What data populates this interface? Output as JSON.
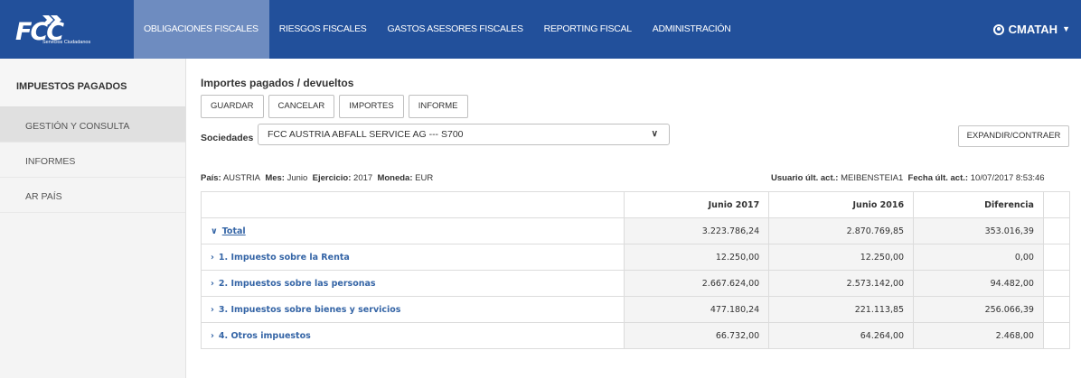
{
  "header": {
    "logo_text": "FCC",
    "logo_sub": "Servicios Ciudadanos",
    "nav": [
      {
        "label": "OBLIGACIONES FISCALES",
        "active": true
      },
      {
        "label": "RIESGOS FISCALES",
        "active": false
      },
      {
        "label": "GASTOS ASESORES FISCALES",
        "active": false
      },
      {
        "label": "REPORTING FISCAL",
        "active": false
      },
      {
        "label": "ADMINISTRACIÓN",
        "active": false
      }
    ],
    "user": "CMATAH",
    "colors": {
      "bar": "#22509b",
      "active_tab": "#6e8cc0"
    }
  },
  "sidebar": {
    "heading": "IMPUESTOS PAGADOS",
    "items": [
      {
        "label": "GESTIÓN Y CONSULTA",
        "active": true
      },
      {
        "label": "INFORMES",
        "active": false
      },
      {
        "label": "AR PAÍS",
        "active": false
      }
    ]
  },
  "main": {
    "title": "Importes pagados / devueltos",
    "buttons": {
      "save": "GUARDAR",
      "cancel": "CANCELAR",
      "amounts": "IMPORTES",
      "report": "INFORME"
    },
    "sociedades_label": "Sociedades",
    "sociedades_value": "FCC AUSTRIA ABFALL SERVICE AG --- S700",
    "expand_button": "EXPANDIR/CONTRAER",
    "meta": {
      "pais_label": "País:",
      "pais": "AUSTRIA",
      "mes_label": "Mes:",
      "mes": "Junio",
      "ejercicio_label": "Ejercicio:",
      "ejercicio": "2017",
      "moneda_label": "Moneda:",
      "moneda": "EUR",
      "usuario_label": "Usuario últ. act.:",
      "usuario": "MEIBENSTEIA1",
      "fecha_label": "Fecha últ. act.:",
      "fecha": "10/07/2017 8:53:46"
    },
    "table": {
      "headers": [
        "Junio 2017",
        "Junio 2016",
        "Diferencia"
      ],
      "rows": [
        {
          "label": "Total",
          "values": [
            "3.223.786,24",
            "2.870.769,85",
            "353.016,39"
          ]
        },
        {
          "label": "1. Impuesto sobre la Renta",
          "values": [
            "12.250,00",
            "12.250,00",
            "0,00"
          ]
        },
        {
          "label": "2. Impuestos sobre las personas",
          "values": [
            "2.667.624,00",
            "2.573.142,00",
            "94.482,00"
          ]
        },
        {
          "label": "3. Impuestos sobre bienes y servicios",
          "values": [
            "477.180,24",
            "221.113,85",
            "256.066,39"
          ]
        },
        {
          "label": "4. Otros impuestos",
          "values": [
            "66.732,00",
            "64.264,00",
            "2.468,00"
          ]
        }
      ]
    }
  }
}
